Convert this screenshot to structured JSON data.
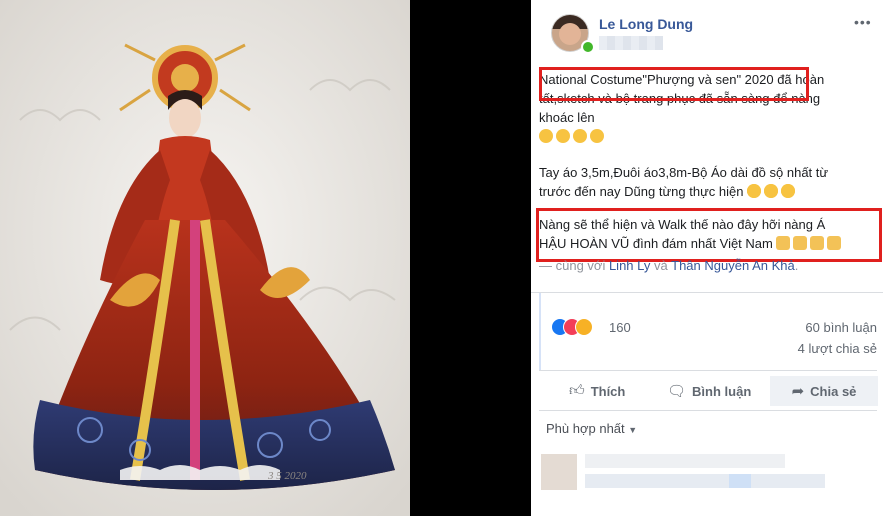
{
  "post": {
    "author": "Le Long Dung",
    "more_icon": "•••",
    "line1": "National Costume\"Phượng và sen\" 2020 đã hoàn",
    "line2": "tất,sketch và bộ trang phục đã sẵn sàng để nàng",
    "line3": "khoác lên",
    "line4": "Tay áo 3,5m,Đuôi áo3,8m-Bộ Áo dài đồ sộ nhất từ",
    "line5": "trước đến nay Dũng từng thực hiện",
    "line6": "Nàng sẽ thể hiện và Walk thế nào đây hỡi nàng Á",
    "line7": "HẬU HOÀN VŨ đình đám nhất Việt Nam",
    "tag_prefix": "— cùng với",
    "tag_person1": "Linh Ly",
    "tag_and": "và",
    "tag_person2": "Thân Nguyễn An Khả",
    "tag_end": "."
  },
  "reactions": {
    "count": "160",
    "comments": "60 bình luận",
    "shares": "4 lượt chia sẻ"
  },
  "actions": {
    "like": "Thích",
    "comment": "Bình luận",
    "share": "Chia sẻ"
  },
  "comments": {
    "sort_label": "Phù hợp nhất"
  },
  "colors": {
    "link": "#385898",
    "highlight_box": "#e0201e",
    "like_blue": "#1877f2"
  },
  "photo": {
    "signature": "3 5 2020"
  }
}
